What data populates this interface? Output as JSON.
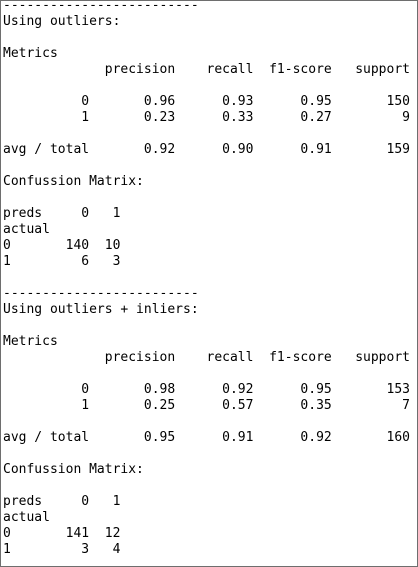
{
  "console": {
    "lines": [
      "-------------------------",
      "Using outliers:",
      "",
      "Metrics",
      "             precision    recall  f1-score   support",
      "",
      "          0       0.96      0.93      0.95       150",
      "          1       0.23      0.33      0.27         9",
      "",
      "avg / total       0.92      0.90      0.91       159",
      "",
      "Confussion Matrix:",
      "",
      "preds     0   1",
      "actual",
      "0       140  10",
      "1         6   3",
      "",
      "-------------------------",
      "Using outliers + inliers:",
      "",
      "Metrics",
      "             precision    recall  f1-score   support",
      "",
      "          0       0.98      0.92      0.95       153",
      "          1       0.25      0.57      0.35         7",
      "",
      "avg / total       0.95      0.91      0.92       160",
      "",
      "Confussion Matrix:",
      "",
      "preds     0   1",
      "actual",
      "0       141  12",
      "1         3   4"
    ]
  }
}
